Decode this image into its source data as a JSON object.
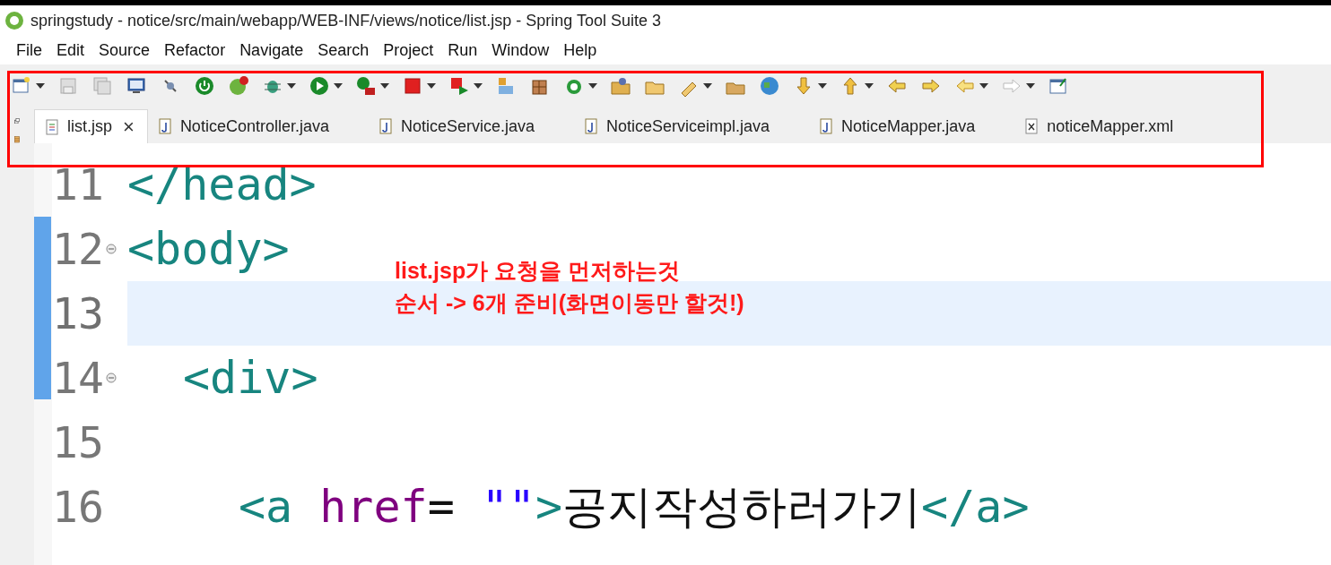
{
  "window": {
    "title": "springstudy - notice/src/main/webapp/WEB-INF/views/notice/list.jsp - Spring Tool Suite 3"
  },
  "menu": [
    "File",
    "Edit",
    "Source",
    "Refactor",
    "Navigate",
    "Search",
    "Project",
    "Run",
    "Window",
    "Help"
  ],
  "tabs": [
    {
      "label": "list.jsp",
      "kind": "jsp",
      "selected": true,
      "close": "×"
    },
    {
      "label": "NoticeController.java",
      "kind": "java",
      "selected": false
    },
    {
      "label": "NoticeService.java",
      "kind": "java",
      "selected": false
    },
    {
      "label": "NoticeServiceimpl.java",
      "kind": "java",
      "selected": false
    },
    {
      "label": "NoticeMapper.java",
      "kind": "java",
      "selected": false
    },
    {
      "label": "noticeMapper.xml",
      "kind": "xml",
      "selected": false
    }
  ],
  "editor": {
    "lines": [
      {
        "number": "11",
        "current": false,
        "folding": false,
        "tokens": [
          {
            "kind": "tag",
            "text": "</head>"
          }
        ]
      },
      {
        "number": "12",
        "current": false,
        "folding": true,
        "tokens": [
          {
            "kind": "tag",
            "text": "<body>"
          }
        ],
        "children": [
          {
            "number": "13",
            "current": true,
            "folding": false
          },
          {
            "number": "14",
            "current": false,
            "folding": true,
            "tokens": [
              {
                "kind": "tag",
                "text": "<div>"
              }
            ],
            "children": [
              {
                "number": "15",
                "current": false,
                "folding": false
              },
              {
                "number": "16",
                "current": false,
                "folding": false,
                "tokens": [
                  {
                    "kind": "tag",
                    "text": "<a"
                  },
                  {
                    "kind": "attr",
                    "text": "href"
                  },
                  {
                    "kind": "plain",
                    "text": "="
                  },
                  {
                    "kind": "string",
                    "text": "\"\""
                  },
                  {
                    "kind": "tag",
                    "text": ">"
                  },
                  {
                    "kind": "plain",
                    "text": "공지작성하러가기"
                  },
                  {
                    "kind": "tag",
                    "text": "</a>"
                  }
                ]
              }
            ]
          }
        ]
      }
    ]
  },
  "annotation": {
    "lines": [
      "list.jsp가 요청을 먼저하는것",
      "순서 -> 6개 준비(화면이동만 할것!)"
    ]
  }
}
